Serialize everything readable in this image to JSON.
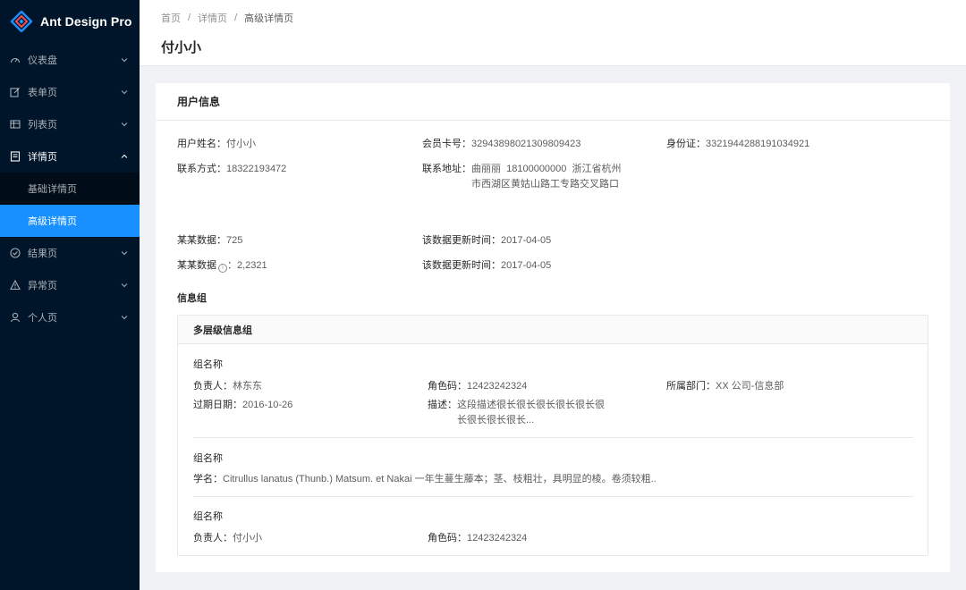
{
  "app": {
    "title": "Ant Design Pro"
  },
  "sidebar": {
    "items": [
      {
        "label": "仪表盘",
        "icon": "dashboard-icon"
      },
      {
        "label": "表单页",
        "icon": "form-icon"
      },
      {
        "label": "列表页",
        "icon": "table-icon"
      },
      {
        "label": "详情页",
        "icon": "profile-icon",
        "open": true,
        "children": [
          {
            "label": "基础详情页"
          },
          {
            "label": "高级详情页",
            "active": true
          }
        ]
      },
      {
        "label": "结果页",
        "icon": "check-circle-icon"
      },
      {
        "label": "异常页",
        "icon": "warning-icon"
      },
      {
        "label": "个人页",
        "icon": "user-icon"
      }
    ],
    "accent": "#1890ff",
    "bg": "#001529"
  },
  "breadcrumb": {
    "home": "首页",
    "mid": "详情页",
    "current": "高级详情页",
    "sep": "/"
  },
  "page": {
    "title": "付小小"
  },
  "card": {
    "title": "用户信息",
    "fields": {
      "name": {
        "label": "用户姓名：",
        "value": "付小小"
      },
      "member": {
        "label": "会员卡号：",
        "value": "32943898021309809423"
      },
      "idcard": {
        "label": "身份证：",
        "value": "3321944288191034921"
      },
      "phone": {
        "label": "联系方式：",
        "value": "18322193472"
      },
      "address": {
        "label": "联系地址：",
        "line1": "曲丽丽  18100000000  浙江省杭州",
        "line2": "市西湖区黄姑山路工专路交叉路口"
      },
      "data1": {
        "label": "某某数据：",
        "value": "725"
      },
      "update1": {
        "label": "该数据更新时间：",
        "value": "2017-04-05"
      },
      "data2": {
        "label": "某某数据",
        "value": "：2,2321",
        "info": "i"
      },
      "update2": {
        "label": "该数据更新时间：",
        "value": "2017-04-05"
      }
    },
    "group_title": "信息组",
    "inner": {
      "title": "多层级信息组",
      "g1": {
        "name": "组名称",
        "owner": {
          "label": "负责人：",
          "value": "林东东"
        },
        "role": {
          "label": "角色码：",
          "value": "12423242324"
        },
        "dept": {
          "label": "所属部门：",
          "value": "XX 公司-信息部"
        },
        "expire": {
          "label": "过期日期：",
          "value": "2016-10-26"
        },
        "desc": {
          "label": "描述：",
          "line1": "这段描述很长很长很长很长很长很",
          "line2": "长很长很长很长..."
        }
      },
      "g2": {
        "name": "组名称",
        "sci": {
          "label": "学名：",
          "value": "Citrullus lanatus (Thunb.) Matsum. et Nakai 一年生蔓生藤本；茎、枝粗壮，具明显的棱。卷须较粗.."
        }
      },
      "g3": {
        "name": "组名称",
        "owner": {
          "label": "负责人：",
          "value": "付小小"
        },
        "role": {
          "label": "角色码：",
          "value": "12423242324"
        }
      }
    }
  }
}
